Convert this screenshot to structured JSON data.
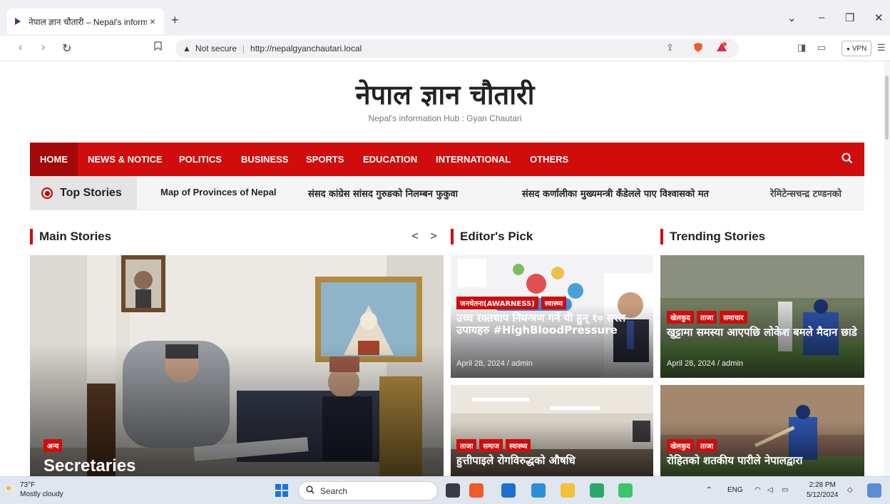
{
  "browser": {
    "tab_title": "नेपाल ज्ञान चौतारी – Nepal's inform",
    "new_tab": "+",
    "not_secure": "Not secure",
    "url": "http://nepalgyanchautari.local",
    "vpn": "VPN"
  },
  "site": {
    "title": "नेपाल ज्ञान चौतारी",
    "tagline": "Nepal's information Hub : Gyan Chautari"
  },
  "nav": {
    "items": [
      "HOME",
      "NEWS & NOTICE",
      "POLITICS",
      "BUSINESS",
      "SPORTS",
      "EDUCATION",
      "INTERNATIONAL",
      "OTHERS"
    ]
  },
  "ticker": {
    "label": "Top Stories",
    "items": [
      "Map of Provinces of Nepal",
      "संसद कांग्रेस सांसद गुरुङको निलम्बन फुकुवा",
      "संसद कर्णालीका मुख्यमन्त्री कँडेलले पाए विश्वासको मत",
      "रेमिटेन्सचन्द्र टण्डनको"
    ]
  },
  "sections": {
    "main": "Main Stories",
    "editor": "Editor's Pick",
    "trending": "Trending Stories",
    "prev": "<",
    "next": ">"
  },
  "main_story": {
    "category": "अन्य",
    "title": "Secretaries"
  },
  "editor_cards": [
    {
      "categories": [
        "जनचेतना(AWARNESS)",
        "स्वास्थ्य"
      ],
      "title": "उच्च रक्तचाप नियन्त्रण गर्ने यी हुन् १० सरल उपायहरु #HighBloodPressure",
      "meta": "April 28, 2024 / admin"
    },
    {
      "categories": [
        "ताजा",
        "समाज",
        "स्वास्थ्य"
      ],
      "title": "हुत्तीपाइले रोगविरुद्धको औषधि"
    }
  ],
  "trending_cards": [
    {
      "categories": [
        "खेलकुद",
        "ताजा",
        "समाचार"
      ],
      "title": "खुट्टामा समस्या आएपछि लोकेश बमले मैदान छाडे",
      "meta": "April 28, 2024 / admin"
    },
    {
      "categories": [
        "खेलकुद",
        "ताजा"
      ],
      "title": "रोहितको शतकीय पारीले नेपालद्वारा"
    }
  ],
  "taskbar": {
    "temp": "73°F",
    "weather": "Mostly cloudy",
    "search": "Search",
    "lang": "ENG",
    "time": "2:28 PM",
    "date": "5/12/2024"
  }
}
